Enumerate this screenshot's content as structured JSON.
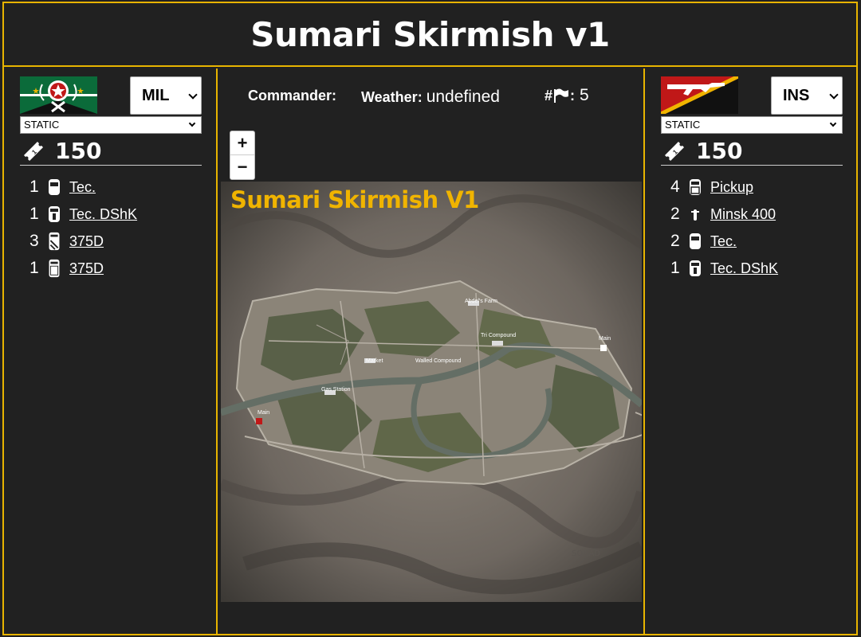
{
  "page": {
    "title": "Sumari Skirmish v1"
  },
  "left_team": {
    "faction": "MIL",
    "mode": "STATIC",
    "tickets": "150",
    "flag_colors": {
      "top": "#0b6b3a",
      "bottom": "#111111"
    },
    "units": [
      {
        "qty": "1",
        "name": "Tec.",
        "icon": "technical-icon"
      },
      {
        "qty": "1",
        "name": "Tec. DShK",
        "icon": "technical-mg-icon"
      },
      {
        "qty": "3",
        "name": "375D",
        "icon": "truck-icon"
      },
      {
        "qty": "1",
        "name": "375D",
        "icon": "truck-icon"
      }
    ]
  },
  "right_team": {
    "faction": "INS",
    "mode": "STATIC",
    "tickets": "150",
    "flag_colors": {
      "top": "#c01818",
      "bottom": "#111111",
      "stripe": "#f0b400"
    },
    "units": [
      {
        "qty": "4",
        "name": "Pickup",
        "icon": "pickup-icon"
      },
      {
        "qty": "2",
        "name": "Minsk 400",
        "icon": "motorbike-icon"
      },
      {
        "qty": "2",
        "name": "Tec.",
        "icon": "technical-icon"
      },
      {
        "qty": "1",
        "name": "Tec. DShK",
        "icon": "technical-mg-icon"
      }
    ]
  },
  "info": {
    "commander_label": "Commander:",
    "weather_label": "Weather:",
    "weather_value": "undefined",
    "flags_prefix": "#",
    "flags_value": "5"
  },
  "zoom": {
    "in": "+",
    "out": "−"
  },
  "map": {
    "title": "Sumari Skirmish V1",
    "labels": {
      "abdels_farm": "Abdel's Farm",
      "tri_compound": "Tri Compound",
      "market": "Market",
      "walled_compound": "Walled Compound",
      "gas_station": "Gas Station",
      "main_west": "Main",
      "main_east": "Main"
    }
  },
  "colors": {
    "accent": "#e8b400",
    "map_title": "#f0b400",
    "background": "#212121"
  }
}
